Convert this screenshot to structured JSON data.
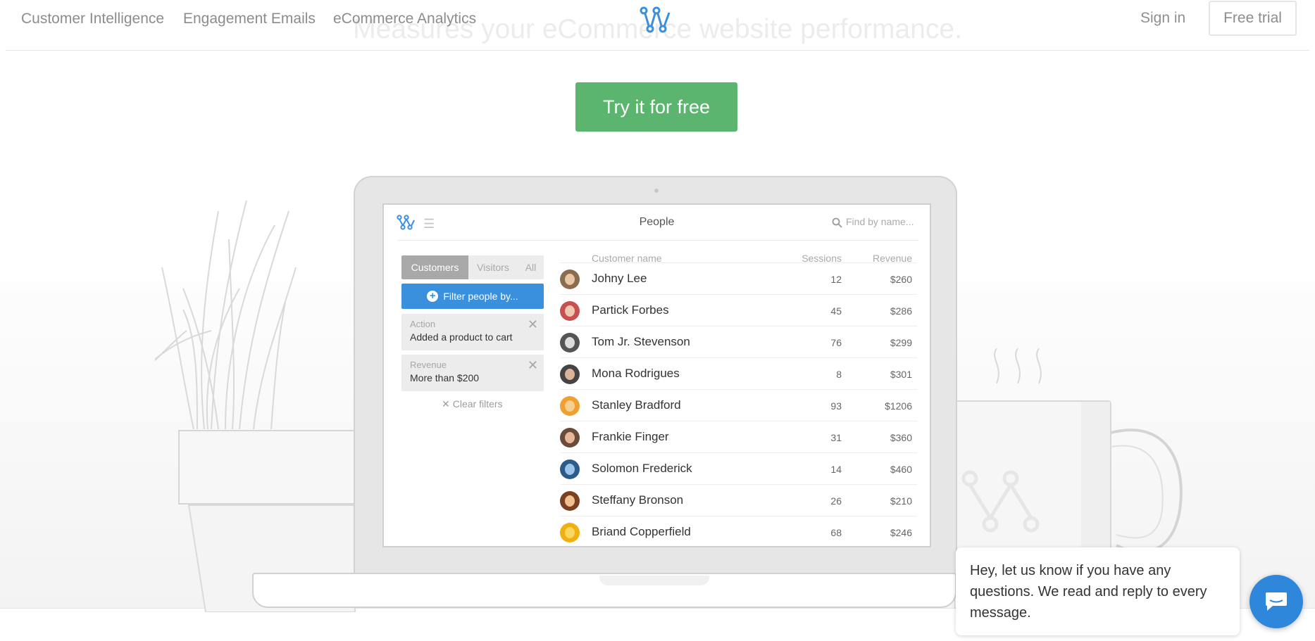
{
  "nav": {
    "links": [
      "Customer Intelligence",
      "Engagement Emails",
      "eCommerce Analytics"
    ],
    "sign_in": "Sign in",
    "free_trial": "Free trial"
  },
  "hero": {
    "tagline": "Measures your eCommerce website performance.",
    "cta": "Try it for free"
  },
  "app": {
    "title": "People",
    "search_placeholder": "Find by name...",
    "segments": [
      "Customers",
      "Visitors",
      "All"
    ],
    "active_segment": "Customers",
    "filter_button": "Filter people by...",
    "filters": [
      {
        "label": "Action",
        "value": "Added a product to cart"
      },
      {
        "label": "Revenue",
        "value": "More than $200"
      }
    ],
    "clear_filters": "Clear filters",
    "columns": {
      "name": "Customer name",
      "sessions": "Sessions",
      "revenue": "Revenue"
    },
    "rows": [
      {
        "name": "Johny Lee",
        "sessions": "12",
        "revenue": "$260"
      },
      {
        "name": "Partick Forbes",
        "sessions": "45",
        "revenue": "$286"
      },
      {
        "name": "Tom Jr. Stevenson",
        "sessions": "76",
        "revenue": "$299"
      },
      {
        "name": "Mona Rodrigues",
        "sessions": "8",
        "revenue": "$301"
      },
      {
        "name": "Stanley Bradford",
        "sessions": "93",
        "revenue": "$1206"
      },
      {
        "name": "Frankie Finger",
        "sessions": "31",
        "revenue": "$360"
      },
      {
        "name": "Solomon Frederick",
        "sessions": "14",
        "revenue": "$460"
      },
      {
        "name": "Steffany Bronson",
        "sessions": "26",
        "revenue": "$210"
      },
      {
        "name": "Briand Copperfield",
        "sessions": "68",
        "revenue": "$246"
      }
    ]
  },
  "chat": {
    "message": "Hey, let us know if you have any questions. We read and reply to every message."
  },
  "colors": {
    "brand_blue": "#3a90dd",
    "cta_green": "#5bb56f",
    "chat_blue": "#2f87dc"
  }
}
